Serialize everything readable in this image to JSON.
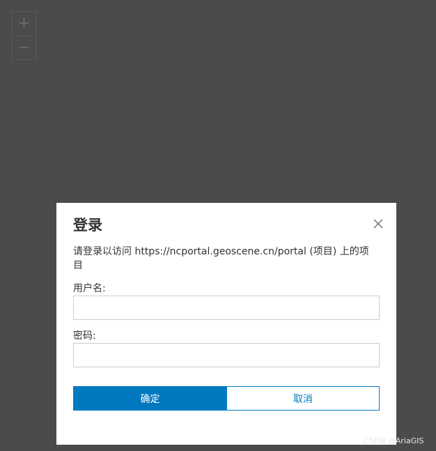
{
  "map": {
    "zoom_in_label": "+",
    "zoom_out_label": "−"
  },
  "dialog": {
    "title": "登录",
    "message": "请登录以访问 https://ncportal.geoscene.cn/portal (项目) 上的项目",
    "username_label": "用户名:",
    "username_value": "",
    "password_label": "密码:",
    "password_value": "",
    "ok_label": "确定",
    "cancel_label": "取消"
  },
  "colors": {
    "primary": "#0079c1",
    "map_background": "#4b4b4b"
  },
  "watermark": "CSDN @AriaGIS"
}
